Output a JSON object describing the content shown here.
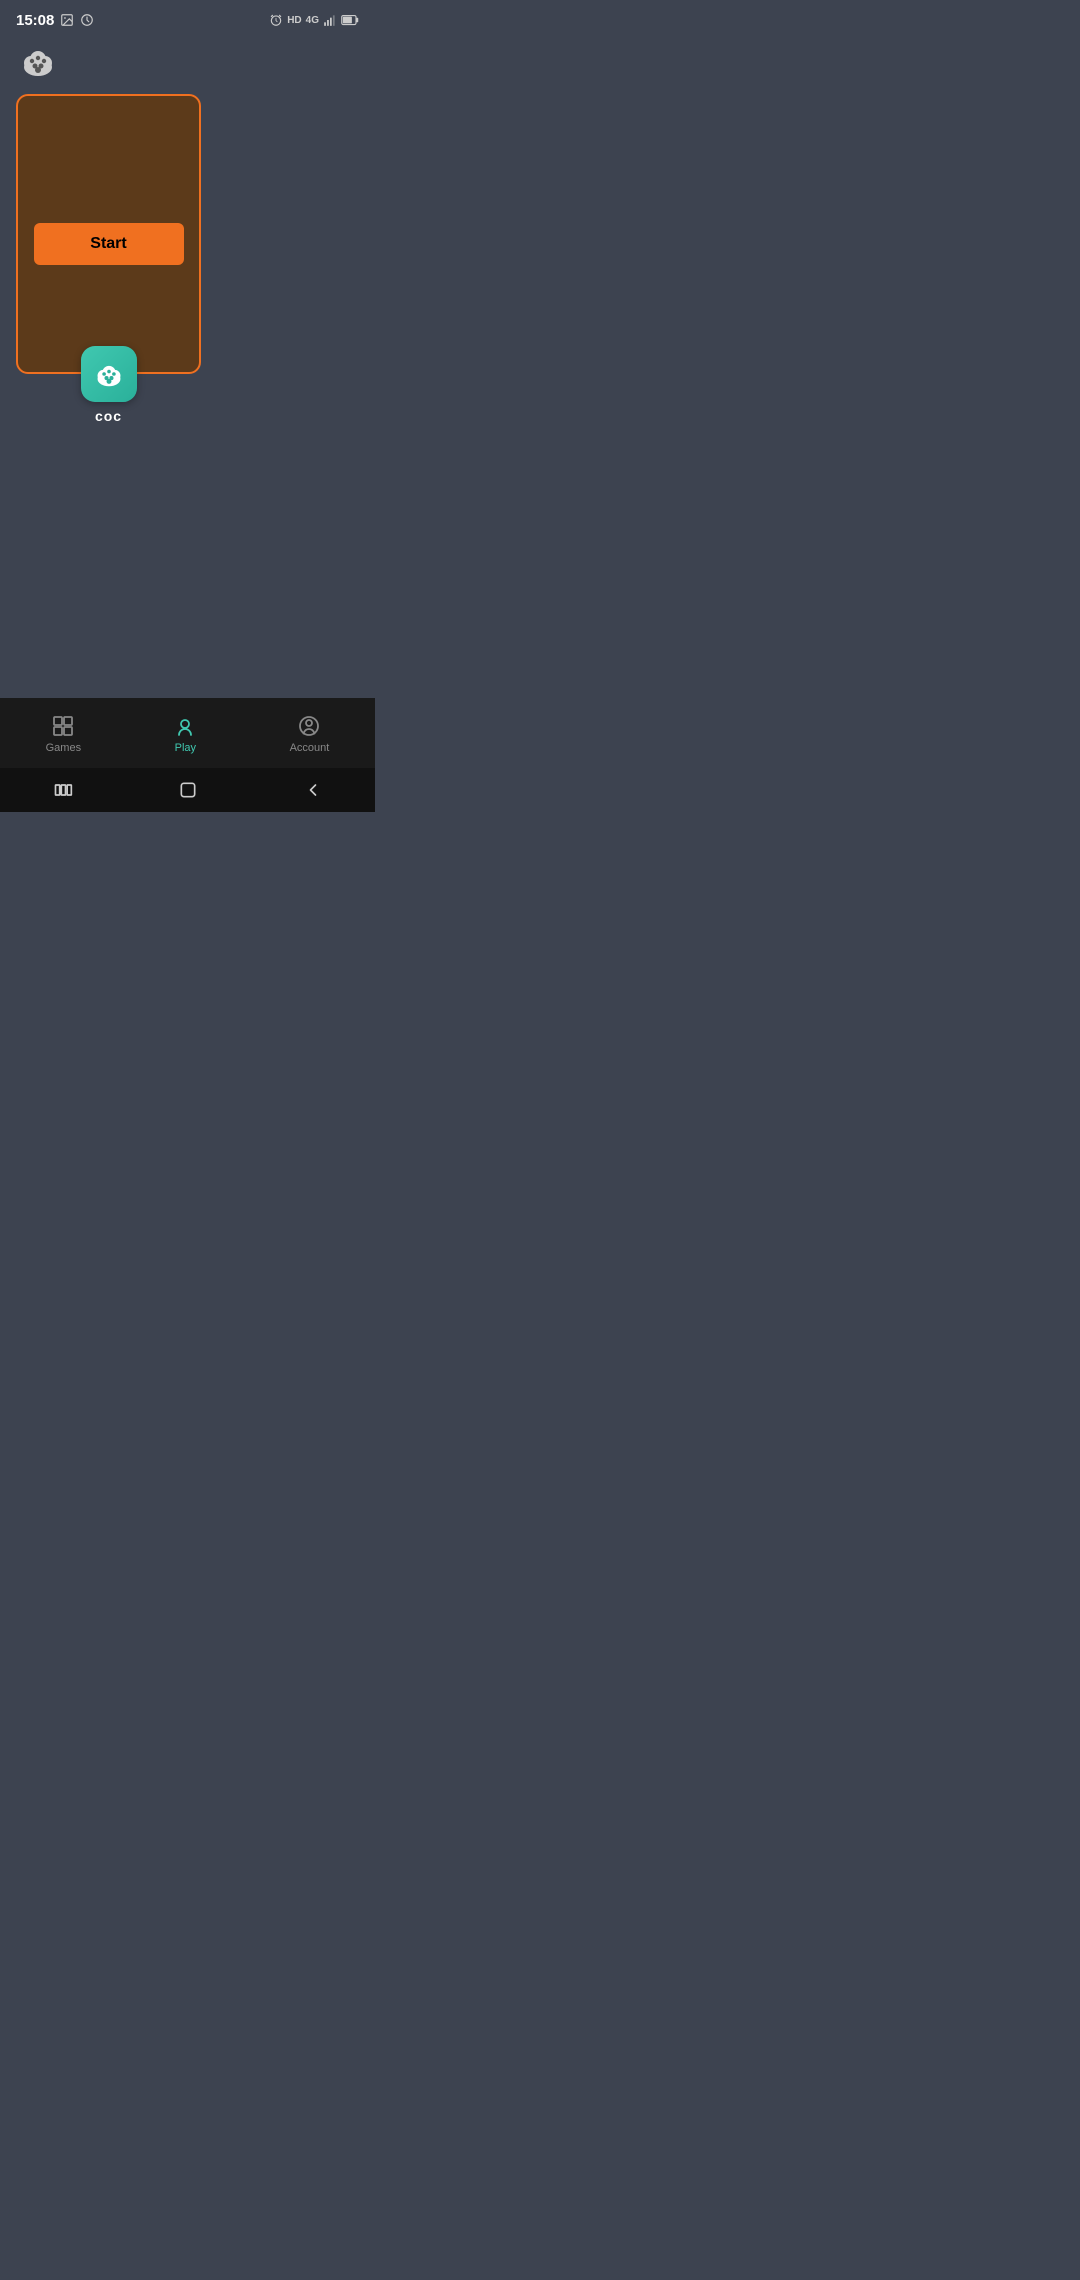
{
  "statusBar": {
    "time": "15:08",
    "leftIcons": [
      "image-icon",
      "history-icon"
    ],
    "rightIcons": [
      "alarm-icon",
      "hd-badge",
      "4g-icon",
      "signal-icon",
      "battery-icon"
    ]
  },
  "appLogo": {
    "icon": "paw-cloud-icon"
  },
  "gameCard": {
    "startButtonLabel": "Start",
    "appIconLabel": "coc"
  },
  "bottomNav": {
    "items": [
      {
        "id": "games",
        "label": "Games",
        "active": false
      },
      {
        "id": "play",
        "label": "Play",
        "active": true
      },
      {
        "id": "account",
        "label": "Account",
        "active": false
      }
    ]
  },
  "androidNav": {
    "buttons": [
      "recents",
      "home",
      "back"
    ]
  }
}
